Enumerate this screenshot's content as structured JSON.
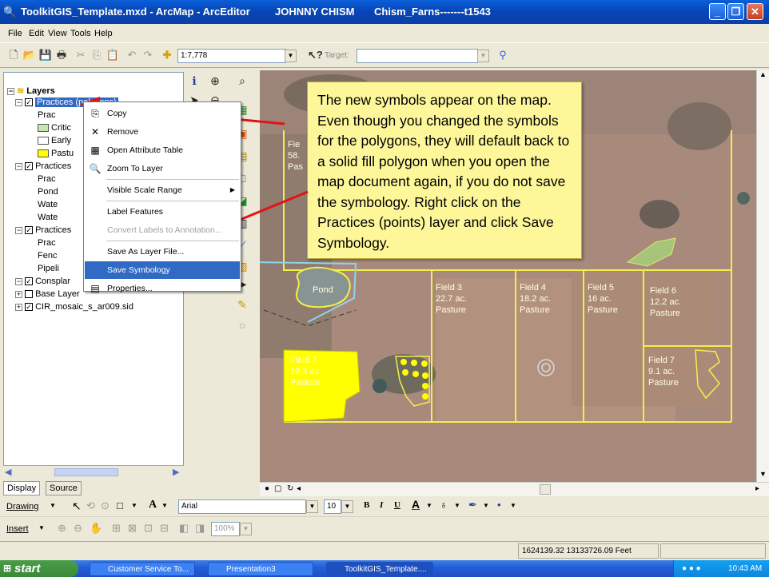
{
  "window": {
    "title": "ToolkitGIS_Template.mxd - ArcMap - ArcEditor",
    "user": "JOHNNY CHISM",
    "doc": "Chism_Farns-------t1543"
  },
  "menu": [
    "File",
    "Edit",
    "View",
    "Tools",
    "Help"
  ],
  "toolbar": {
    "scale": "1:7,778",
    "target_label": "Target:"
  },
  "toc": {
    "root": "Layers",
    "rows": [
      {
        "label": "Practices (polygons)",
        "level": 1,
        "checked": true,
        "selected": true
      },
      {
        "label": "Prac",
        "level": 2
      },
      {
        "label": "Critic",
        "level": 2,
        "swatch": "#c9e6b0"
      },
      {
        "label": "Early",
        "level": 2,
        "swatch": "#ffffff"
      },
      {
        "label": "Pastu",
        "level": 2,
        "swatch": "#ffff00"
      },
      {
        "label": "Practices",
        "level": 1,
        "checked": true
      },
      {
        "label": "Prac",
        "level": 2
      },
      {
        "label": "Pond",
        "level": 2
      },
      {
        "label": "Wate",
        "level": 2
      },
      {
        "label": "Wate",
        "level": 2
      },
      {
        "label": "Practices",
        "level": 1,
        "checked": true
      },
      {
        "label": "Prac",
        "level": 2
      },
      {
        "label": "Fenc",
        "level": 2
      },
      {
        "label": "Pipeli",
        "level": 2
      },
      {
        "label": "Consplar",
        "level": 1,
        "checked": true
      },
      {
        "label": "Base Layer",
        "level": 1,
        "checked": false
      },
      {
        "label": "CIR_mosaic_s_ar009.sid",
        "level": 1,
        "checked": true
      }
    ],
    "tab_display": "Display",
    "tab_source": "Source"
  },
  "context_menu": [
    {
      "label": "Copy",
      "icon": "copy-icon"
    },
    {
      "label": "Remove",
      "icon": "remove-icon"
    },
    {
      "label": "Open Attribute Table",
      "icon": "table-icon"
    },
    {
      "label": "Zoom To Layer",
      "icon": "zoom-layer-icon"
    },
    {
      "label": "Visible Scale Range",
      "submenu": true
    },
    {
      "label": "Label Features"
    },
    {
      "label": "Convert Labels to Annotation...",
      "disabled": true
    },
    {
      "label": "Save As Layer File..."
    },
    {
      "label": "Save Symbology",
      "selected": true
    },
    {
      "label": "Properties...",
      "icon": "properties-icon"
    }
  ],
  "callout": "The new symbols appear on the map. Even though you changed the symbols for the polygons, they will default back to a solid fill polygon when you open the map document again, if you do not save the symbology. Right click on the Practices (points) layer and click Save Symbology.",
  "map_labels": {
    "pond": "Pond",
    "field1_a": "Fie",
    "field1_b": "58.",
    "field1_c": "Pas",
    "field3": [
      "Field  3",
      "22.7 ac.",
      "Pasture"
    ],
    "field4": [
      "Field  4",
      "18.2 ac.",
      "Pasture"
    ],
    "field5": [
      "Field  5",
      "16 ac.",
      "Pasture"
    ],
    "field6": [
      "Field  6",
      "12.2 ac.",
      "Pasture"
    ],
    "field7a": [
      "Field  7",
      "19.3 ac.",
      "Pasture"
    ],
    "field7b": [
      "Field  7",
      "9.1 ac.",
      "Pasture"
    ]
  },
  "drawing": {
    "drawing_label": "Drawing",
    "font": "Arial",
    "size": "10",
    "insert_label": "Insert",
    "zoom": "100%"
  },
  "status": {
    "coords": "1624139.32  13133726.09 Feet"
  },
  "taskbar": {
    "start": "start",
    "tasks": [
      "Customer Service To...",
      "Presentation3",
      "ToolkitGIS_Template...."
    ],
    "time": "10:43 AM"
  }
}
